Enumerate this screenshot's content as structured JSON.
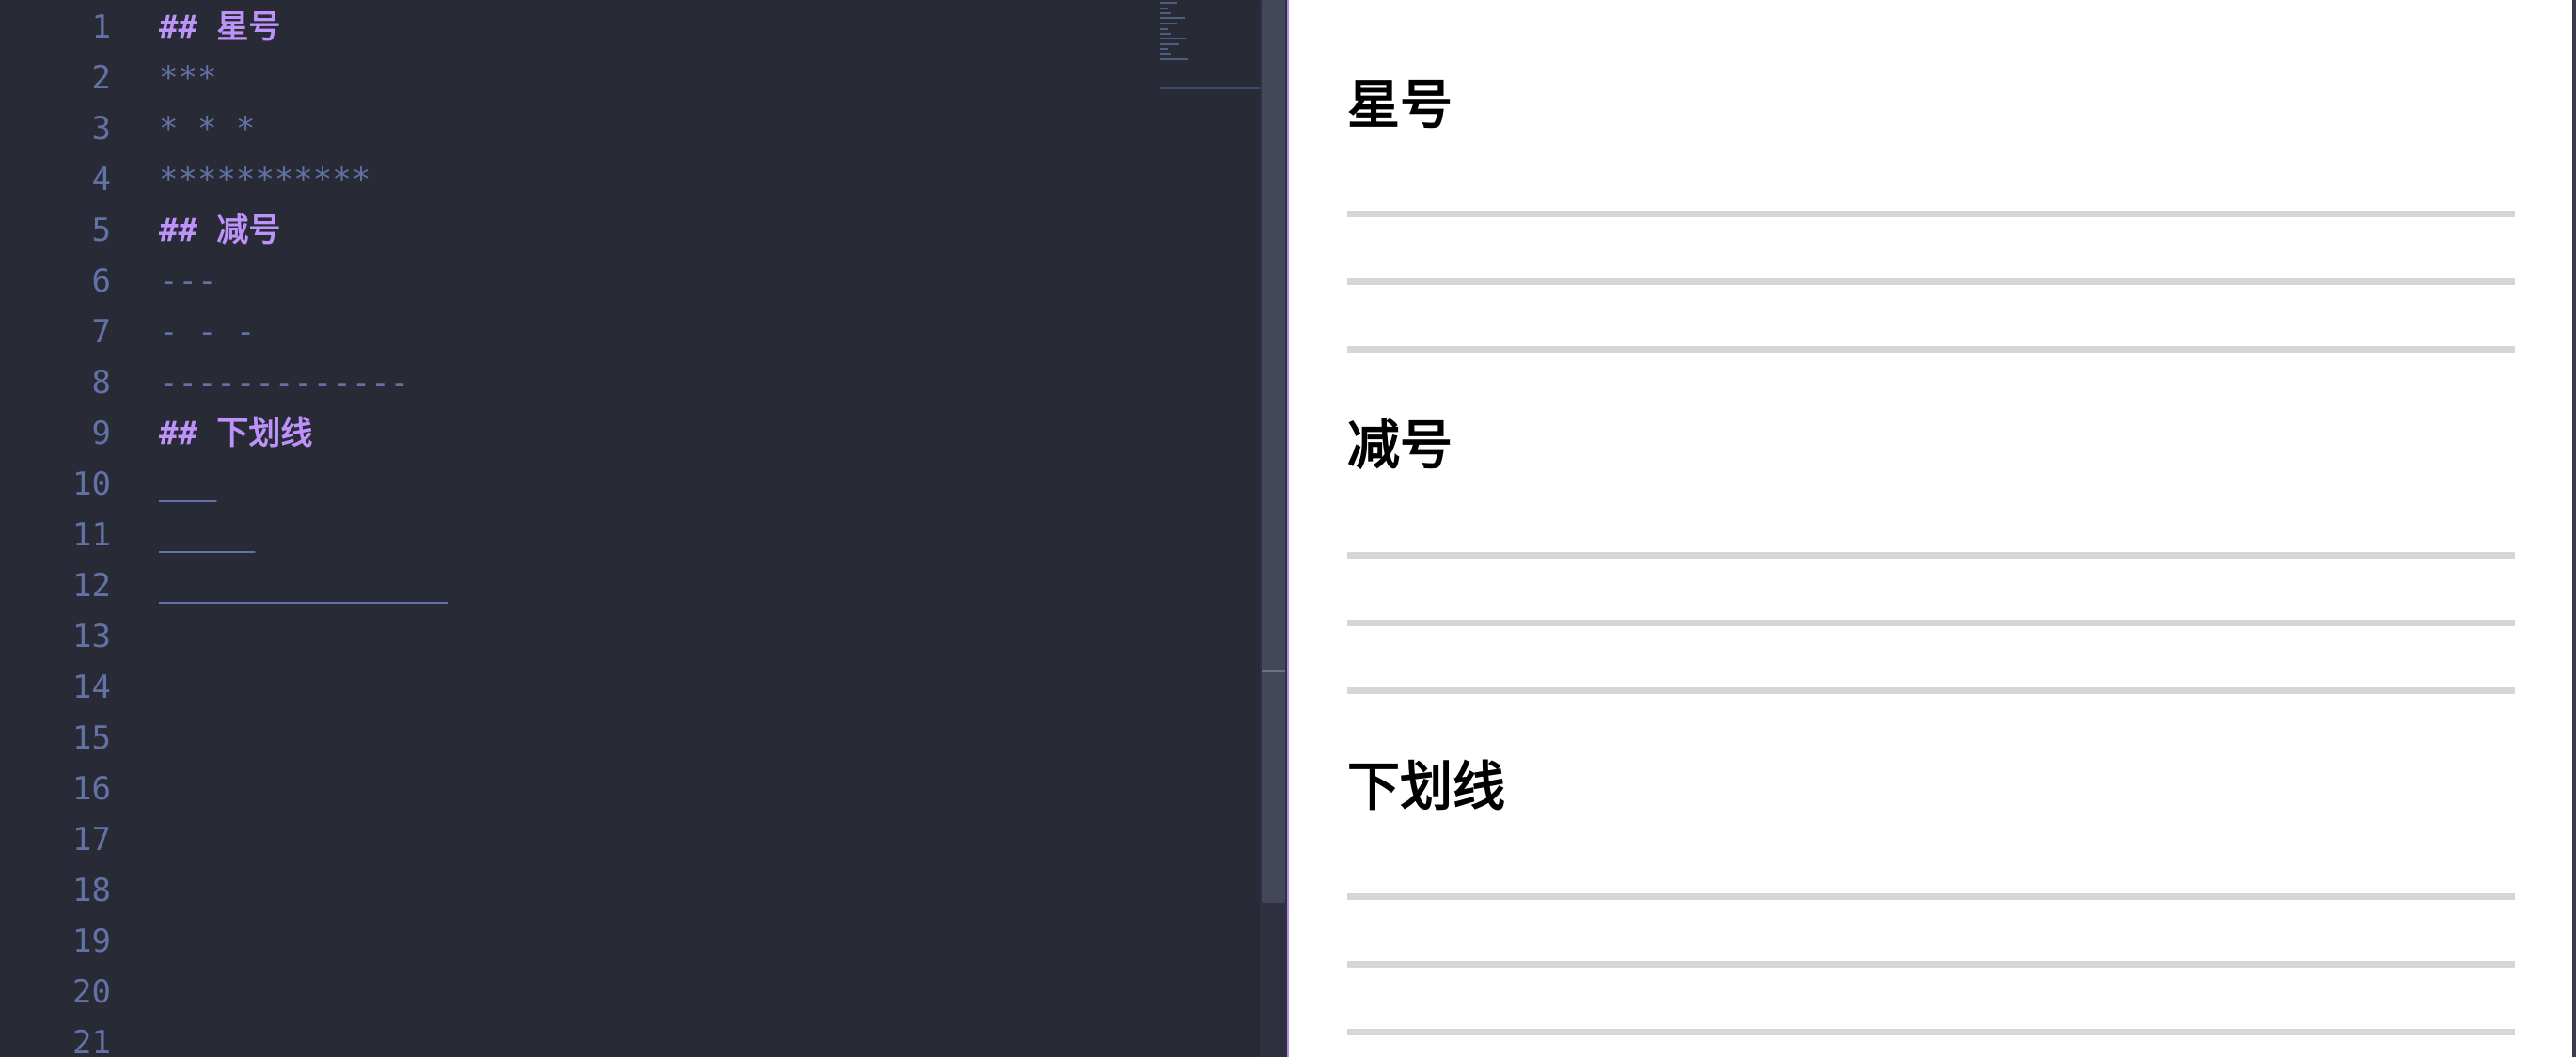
{
  "editor": {
    "line_numbers": [
      "1",
      "2",
      "3",
      "4",
      "5",
      "6",
      "7",
      "8",
      "9",
      "10",
      "11",
      "12",
      "13",
      "14",
      "15",
      "16",
      "17",
      "18",
      "19",
      "20",
      "21"
    ],
    "lines": [
      {
        "text": "## 星号",
        "kind": "heading"
      },
      {
        "text": "***",
        "kind": "rule"
      },
      {
        "text": "* * *",
        "kind": "rule"
      },
      {
        "text": "***********",
        "kind": "rule"
      },
      {
        "text": "## 减号",
        "kind": "heading"
      },
      {
        "text": "---",
        "kind": "rule"
      },
      {
        "text": "- - -",
        "kind": "rule"
      },
      {
        "text": "-------------",
        "kind": "rule"
      },
      {
        "text": "## 下划线",
        "kind": "heading"
      },
      {
        "text": "___",
        "kind": "rule"
      },
      {
        "text": "_ _ _",
        "kind": "rule"
      },
      {
        "text": "_______________",
        "kind": "rule"
      }
    ]
  },
  "preview": {
    "sections": [
      {
        "heading": "星号",
        "rules": 3
      },
      {
        "heading": "减号",
        "rules": 3
      },
      {
        "heading": "下划线",
        "rules": 3
      }
    ]
  },
  "colors": {
    "editor_bg": "#282a36",
    "line_number": "#6272a4",
    "heading": "#bd93f9",
    "comment": "#6272a4",
    "preview_bg": "#ffffff",
    "hr": "#d6d6d6",
    "divider": "#b48be6"
  }
}
